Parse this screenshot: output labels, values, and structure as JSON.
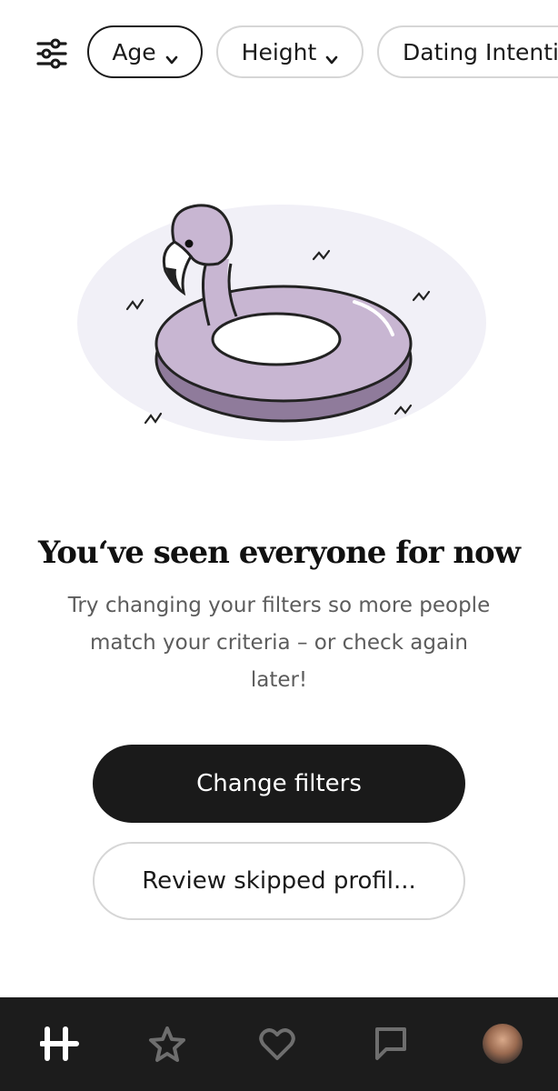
{
  "filters": {
    "icon": "sliders-icon",
    "chips": [
      {
        "label": "Age",
        "active": true
      },
      {
        "label": "Height",
        "active": false
      },
      {
        "label": "Dating Intentions",
        "active": false
      }
    ]
  },
  "empty_state": {
    "illustration": "flamingo-pool-float",
    "title": "You‘ve seen everyone for now",
    "message": "Try changing your filters so more people match your criteria – or check again later!"
  },
  "actions": {
    "primary_label": "Change filters",
    "secondary_label": "Review skipped profil..."
  },
  "bottom_nav": {
    "items": [
      {
        "name": "home",
        "icon": "hinge-logo-icon",
        "active": true
      },
      {
        "name": "standouts",
        "icon": "star-icon",
        "active": false
      },
      {
        "name": "likes",
        "icon": "heart-icon",
        "active": false
      },
      {
        "name": "matches",
        "icon": "chat-icon",
        "active": false
      },
      {
        "name": "profile",
        "icon": "avatar",
        "active": false
      }
    ]
  },
  "colors": {
    "primary": "#1a1a1a",
    "nav_background": "#1c1c1c",
    "flamingo": "#c8b6d2",
    "flamingo_shadow": "#8f7b9b"
  }
}
